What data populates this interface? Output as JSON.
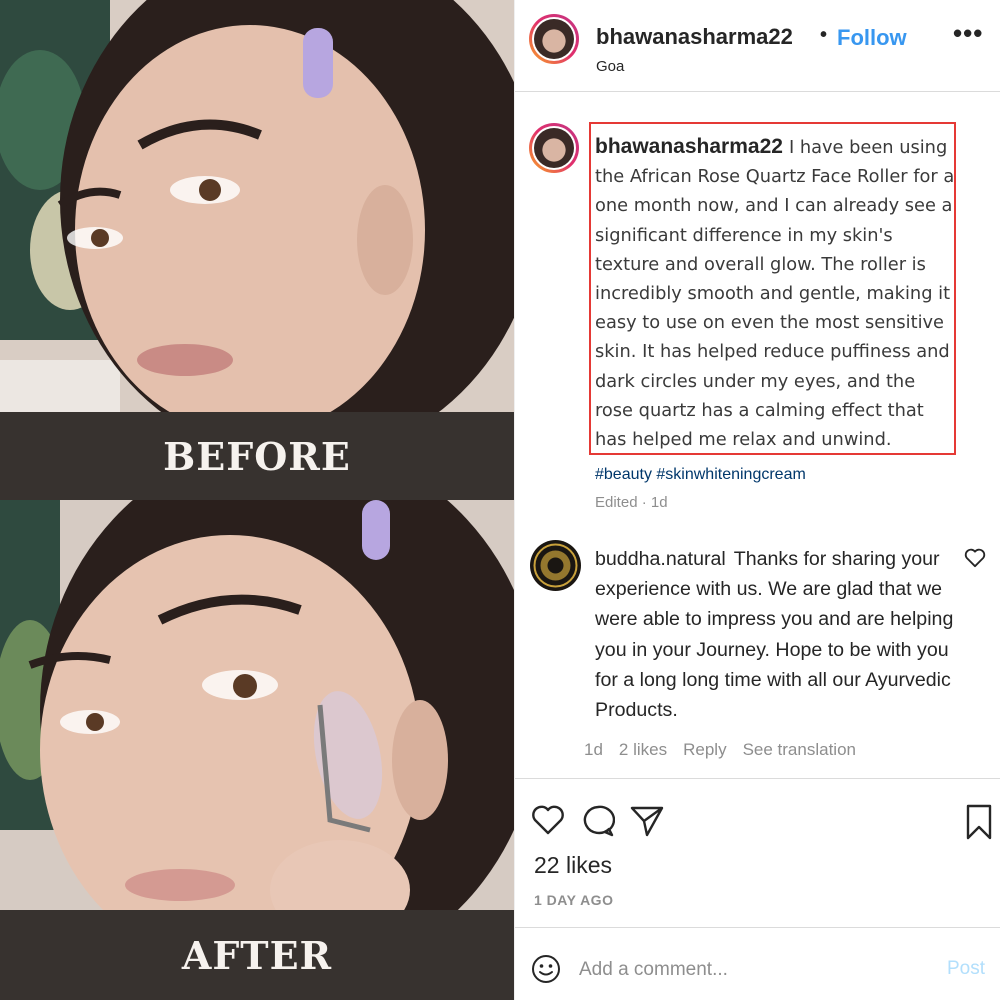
{
  "photos": {
    "before_label": "BEFORE",
    "after_label": "AFTER"
  },
  "header": {
    "username": "bhawanasharma22",
    "separator": "•",
    "follow_label": "Follow",
    "location": "Goa",
    "more_icon": "more-horizontal-icon"
  },
  "caption": {
    "username": "bhawanasharma22",
    "text": "I have been using the African Rose Quartz Face Roller for a one month now, and I can already see a significant difference in my skin's texture and overall glow. The roller is incredibly smooth and gentle, making it easy to use on even the most sensitive skin. It has helped reduce puffiness and dark circles under my eyes, and the rose quartz has a calming effect that has helped me relax and unwind.",
    "hashtags": "#beauty #skinwhiteningcream",
    "edited": "Edited · 1d",
    "highlight_color": "#e53935"
  },
  "comment": {
    "username": "buddha.natural",
    "text": "Thanks for sharing your experience with us. We are glad that we were able to impress you and are helping you in your Journey. Hope to be with you for a long long time with all our Ayurvedic Products.",
    "age": "1d",
    "likes": "2 likes",
    "reply_label": "Reply",
    "translate_label": "See translation"
  },
  "actions": {
    "icons": [
      "heart-icon",
      "comment-icon",
      "share-icon",
      "bookmark-icon"
    ]
  },
  "likes": "22 likes",
  "time_ago": "1 DAY AGO",
  "add_comment": {
    "placeholder": "Add a comment...",
    "post_label": "Post"
  },
  "colors": {
    "link_blue": "#3897f0",
    "hashtag": "#00376b",
    "muted": "#8e8e8e",
    "post_disabled": "#b2dffc"
  }
}
